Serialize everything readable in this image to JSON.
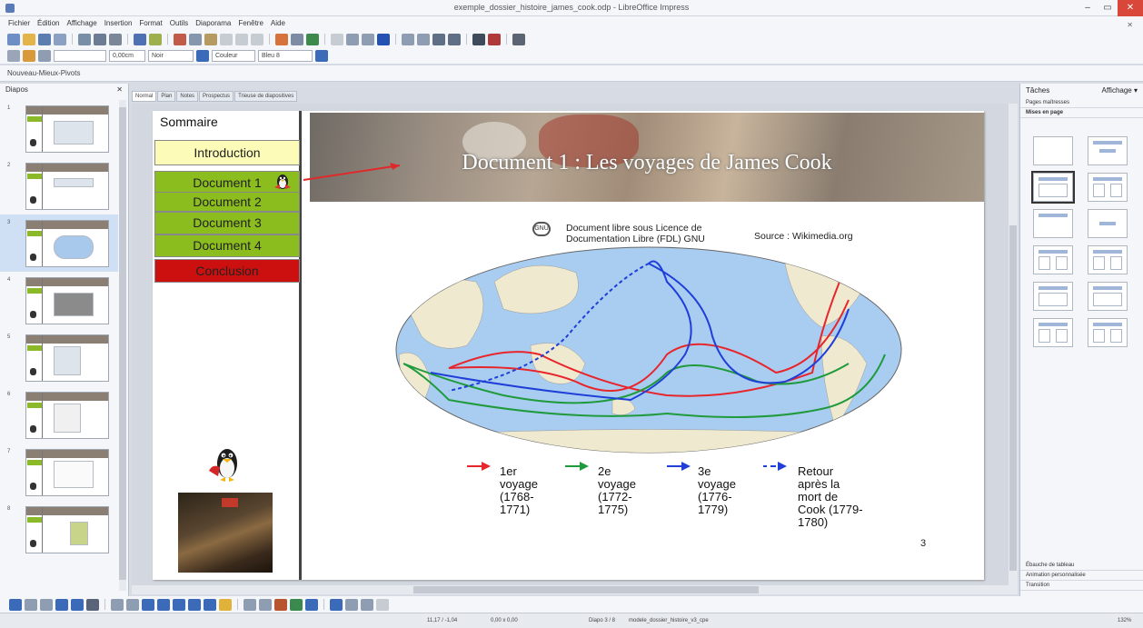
{
  "window": {
    "title": "exemple_dossier_histoire_james_cook.odp - LibreOffice Impress",
    "controls": [
      "–",
      "▭",
      "✕"
    ]
  },
  "menubar": [
    "Fichier",
    "Édition",
    "Affichage",
    "Insertion",
    "Format",
    "Outils",
    "Diaporama",
    "Fenêtre",
    "Aide"
  ],
  "toolbar": {
    "line_width": "0,00cm",
    "line_color": "Noir",
    "area_type": "Couleur",
    "area_color": "Bleu 8",
    "style_label": "Nouveau-Mieux-Pivots"
  },
  "slides_pane": {
    "title": "Diapos",
    "slide_numbers": [
      "1",
      "2",
      "3",
      "4",
      "5",
      "6",
      "7",
      "8"
    ],
    "selected_index": 2
  },
  "view_tabs": [
    "Normal",
    "Plan",
    "Notes",
    "Prospectus",
    "Trieuse de diapositives"
  ],
  "slide": {
    "sommaire": "Sommaire",
    "nav": {
      "intro": "Introduction",
      "doc1": "Document 1",
      "doc2": "Document 2",
      "doc3": "Document 3",
      "doc4": "Document 4",
      "conclusion": "Conclusion"
    },
    "title": "Document 1 : Les voyages de James Cook",
    "credit_line1": "Document libre sous Licence de",
    "credit_line2": "Documentation Libre (FDL) GNU",
    "source": "Source : Wikimedia.org",
    "legend": [
      {
        "line1": "1er",
        "line2": "voyage",
        "line3": "(1768-",
        "line4": "1771)",
        "color": "#e8252b"
      },
      {
        "line1": "2e",
        "line2": "voyage",
        "line3": "(1772-",
        "line4": "1775)",
        "color": "#1f9a3c"
      },
      {
        "line1": "3e",
        "line2": "voyage",
        "line3": "(1776-",
        "line4": "1779)",
        "color": "#1f3fd8"
      },
      {
        "line1": "Retour",
        "line2": "après la",
        "line3": "mort de",
        "line4": "Cook (1779-",
        "line5": "1780)",
        "color": "#1f3fd8"
      }
    ],
    "page_number": "3"
  },
  "tasks_pane": {
    "title": "Tâches",
    "view_label": "Affichage ▾",
    "sections": [
      "Pages maîtresses",
      "Mises en page"
    ],
    "bottom_sections": [
      "Ébauche de tableau",
      "Animation personnalisée",
      "Transition"
    ]
  },
  "statusbar": {
    "position": "11,17 / -1,04",
    "size": "0,00 x 0,00",
    "slide": "Diapo 3 / 8",
    "master": "modele_dossier_histoire_v3_cpe",
    "zoom": "132%"
  }
}
